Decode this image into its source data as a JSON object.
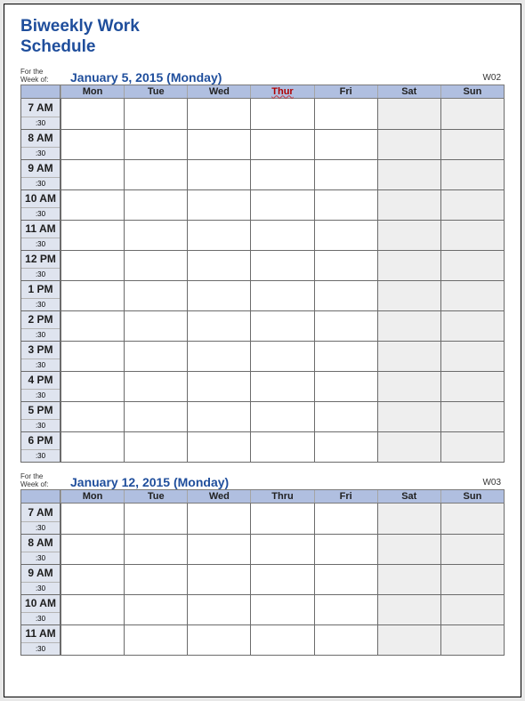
{
  "title_line1": "Biweekly Work",
  "title_line2": "Schedule",
  "for_the_week_of_label_line1": "For the",
  "for_the_week_of_label_line2": "Week of:",
  "half_label": ":30",
  "days": [
    "Mon",
    "Tue",
    "Wed",
    "Thur",
    "Fri",
    "Sat",
    "Sun"
  ],
  "days2": [
    "Mon",
    "Tue",
    "Wed",
    "Thru",
    "Fri",
    "Sat",
    "Sun"
  ],
  "week1": {
    "date": "January 5, 2015 (Monday)",
    "wnum": "W02",
    "hours": [
      "7 AM",
      "8 AM",
      "9 AM",
      "10 AM",
      "11 AM",
      "12 PM",
      "1 PM",
      "2 PM",
      "3 PM",
      "4 PM",
      "5 PM",
      "6 PM"
    ]
  },
  "week2": {
    "date": "January 12, 2015 (Monday)",
    "wnum": "W03",
    "hours": [
      "7 AM",
      "8 AM",
      "9 AM",
      "10 AM",
      "11 AM"
    ]
  }
}
